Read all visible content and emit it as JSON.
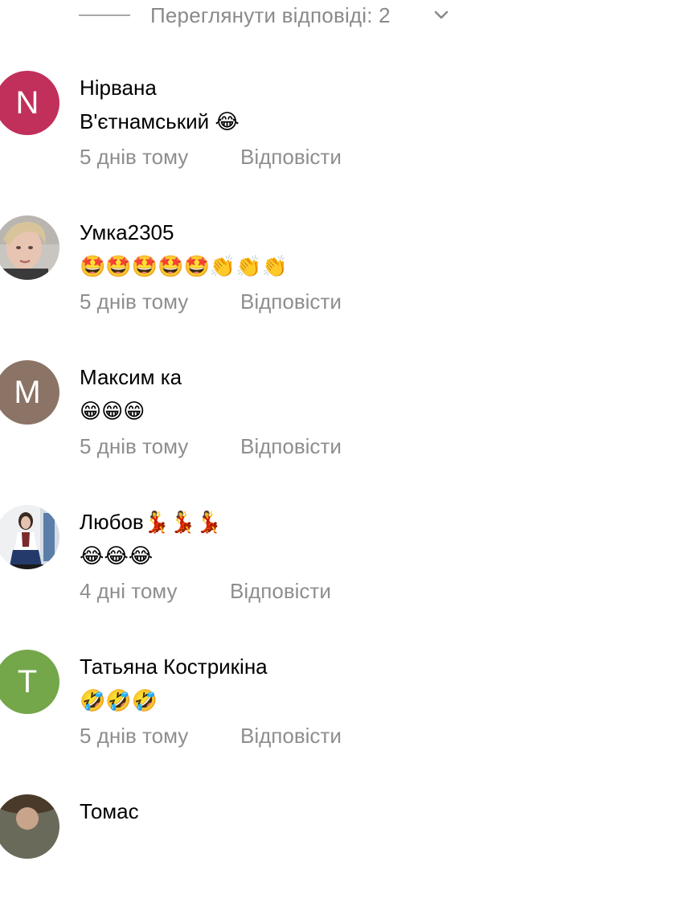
{
  "view_replies": {
    "label": "Переглянути відповіді: 2",
    "icon": "chevron-down-icon"
  },
  "colors": {
    "secondary_text": "#8e8e8e",
    "avatar_n": "#c0305a",
    "avatar_m": "#8b7366",
    "avatar_t": "#74a64a"
  },
  "comments": [
    {
      "author": "Нірвана",
      "avatar_letter": "N",
      "text": "В'єтнамський 😂",
      "time": "5 днів тому",
      "reply_label": "Відповісти"
    },
    {
      "author": "Умка2305",
      "avatar_letter": "",
      "text": "🤩🤩🤩🤩🤩👏👏👏",
      "time": "5 днів тому",
      "reply_label": "Відповісти"
    },
    {
      "author": "Максим ка",
      "avatar_letter": "M",
      "text": "😁😁😁",
      "time": "5 днів тому",
      "reply_label": "Відповісти"
    },
    {
      "author": "Любов💃💃💃",
      "avatar_letter": "",
      "text": "😂😂😂",
      "time": "4 дні тому",
      "reply_label": "Відповісти"
    },
    {
      "author": "Татьяна Кострикіна",
      "avatar_letter": "T",
      "text": "🤣🤣🤣",
      "time": "5 днів тому",
      "reply_label": "Відповісти"
    },
    {
      "author": "Томас",
      "avatar_letter": "",
      "text": "",
      "time": "",
      "reply_label": ""
    }
  ]
}
